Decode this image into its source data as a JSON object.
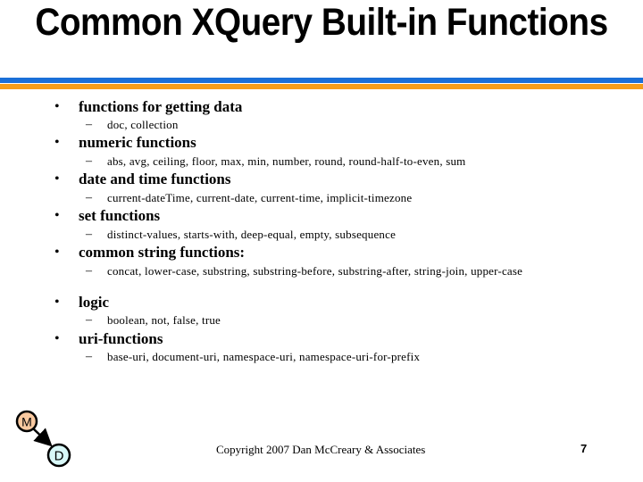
{
  "slide": {
    "title": "Common XQuery Built-in Functions",
    "accent_colors": {
      "top_bar": "#1a6fd8",
      "bottom_bar": "#f59d1a"
    },
    "bullets": [
      {
        "label": "functions for getting data",
        "sub": "doc, collection"
      },
      {
        "label": "numeric functions",
        "sub": "abs, avg, ceiling, floor, max, min, number, round, round-half-to-even, sum"
      },
      {
        "label": "date and time functions",
        "sub": "current-dateTime, current-date, current-time, implicit-timezone"
      },
      {
        "label": "set functions",
        "sub": "distinct-values, starts-with, deep-equal, empty, subsequence"
      },
      {
        "label": "common string functions:",
        "sub": "concat, lower-case, substring, substring-before, substring-after, string-join, upper-case"
      },
      {
        "label": "logic",
        "sub": "boolean, not, false, true"
      },
      {
        "label": "uri-functions",
        "sub": "base-uri, document-uri, namespace-uri, namespace-uri-for-prefix"
      }
    ],
    "bullet_glyph": "•",
    "dash_glyph": "–"
  },
  "logo": {
    "node_m": "M",
    "node_d": "D",
    "node_m_color": "#f9c9a0",
    "node_d_color": "#d8f8f8"
  },
  "footer": {
    "copyright": "Copyright 2007 Dan McCreary & Associates",
    "page_number": "7"
  }
}
